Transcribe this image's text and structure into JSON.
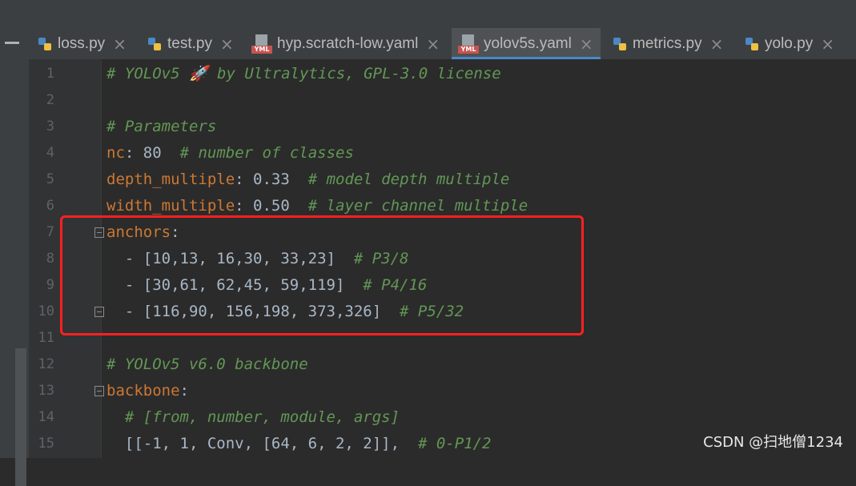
{
  "tabs": [
    {
      "label": "loss.py",
      "icon": "python-file-icon",
      "active": false
    },
    {
      "label": "test.py",
      "icon": "python-file-icon",
      "active": false
    },
    {
      "label": "hyp.scratch-low.yaml",
      "icon": "yaml-file-icon",
      "active": false
    },
    {
      "label": "yolov5s.yaml",
      "icon": "yaml-file-icon",
      "active": true
    },
    {
      "label": "metrics.py",
      "icon": "python-file-icon",
      "active": false
    },
    {
      "label": "yolo.py",
      "icon": "python-file-icon",
      "active": false
    }
  ],
  "icons": {
    "close": "×",
    "yaml_tag": "YML"
  },
  "code": {
    "line1": {
      "num": "1",
      "comment": "# YOLOv5 🚀 by Ultralytics, GPL-3.0 license"
    },
    "line2": {
      "num": "2"
    },
    "line3": {
      "num": "3",
      "comment": "# Parameters"
    },
    "line4": {
      "num": "4",
      "key": "nc",
      "sep": ": ",
      "value": "80",
      "pad": "  ",
      "comment": "# number of classes"
    },
    "line5": {
      "num": "5",
      "key": "depth_multiple",
      "sep": ": ",
      "value": "0.33",
      "pad": "  ",
      "comment": "# model depth multiple"
    },
    "line6": {
      "num": "6",
      "key": "width_multiple",
      "sep": ": ",
      "value": "0.50",
      "pad": "  ",
      "comment": "# layer channel multiple"
    },
    "line7": {
      "num": "7",
      "key": "anchors",
      "sep": ":"
    },
    "line8": {
      "num": "8",
      "text": "  - [10,13, 16,30, 33,23]  ",
      "comment": "# P3/8"
    },
    "line9": {
      "num": "9",
      "text": "  - [30,61, 62,45, 59,119]  ",
      "comment": "# P4/16"
    },
    "line10": {
      "num": "10",
      "text": "  - [116,90, 156,198, 373,326]  ",
      "comment": "# P5/32"
    },
    "line11": {
      "num": "11"
    },
    "line12": {
      "num": "12",
      "comment": "# YOLOv5 v6.0 backbone"
    },
    "line13": {
      "num": "13",
      "key": "backbone",
      "sep": ":"
    },
    "line14": {
      "num": "14",
      "text": "  ",
      "comment": "# [from, number, module, args]"
    },
    "line15": {
      "num": "15",
      "text": "  [[-1, 1, Conv, [64, 6, 2, 2]],  ",
      "comment": "# 0-P1/2"
    }
  },
  "watermark": "CSDN @扫地僧1234",
  "colors": {
    "highlight": "#ff2020",
    "comment": "#629755",
    "key": "#cc7832",
    "tab_active_underline": "#4a88c7"
  }
}
